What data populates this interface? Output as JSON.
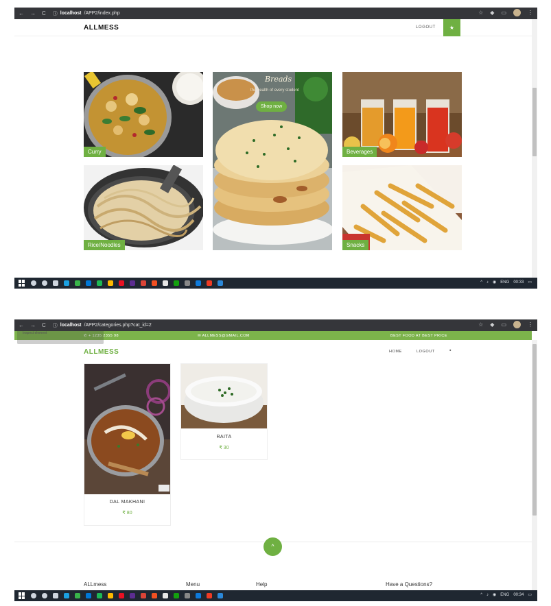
{
  "screenshot1": {
    "browser": {
      "url_host": "localhost",
      "url_path": "/APP2/index.php",
      "nav_back": "←",
      "nav_forward": "→",
      "nav_reload": "C",
      "info_icon": "ⓘ",
      "star_icon": "☆",
      "menu_icon": "⋮"
    },
    "header": {
      "brand": "ALLMESS",
      "logout": "LOGOUT",
      "cart_glyph": "★"
    },
    "tiles": {
      "curry": "Curry",
      "beverages": "Beverages",
      "rice": "Rice/Noodles",
      "snacks": "Snacks"
    },
    "promo": {
      "title": "Breads",
      "subtitle": "the health of every student",
      "button": "Shop now"
    },
    "taskbar": {
      "lang": "ENG",
      "time": "00:33"
    }
  },
  "screenshot2": {
    "browser": {
      "url_host": "localhost",
      "url_path": "/APP2/categories.php?cat_id=2",
      "nav_reload": "C",
      "info_icon": "ⓘ",
      "star_icon": "☆",
      "menu_icon": "⋮"
    },
    "tooltip": "Inspect element",
    "topbar": {
      "phone": "+ 1235 2355 98",
      "email": "ALLMESS@GMAIL.COM",
      "tagline": "BEST FOOD AT BEST PRICE"
    },
    "header": {
      "brand": "ALLMESS",
      "home": "HOME",
      "logout": "LOGOUT",
      "cart_glyph": "🛒"
    },
    "products": [
      {
        "name": "DAL MAKHANI",
        "price": "₹ 80"
      },
      {
        "name": "RAITA",
        "price": "₹ 30"
      }
    ],
    "scroll_top_glyph": "^",
    "footer": {
      "col1": "ALLmess",
      "col2": "Menu",
      "col3": "Help",
      "col4": "Have a Questions?"
    },
    "taskbar": {
      "lang": "ENG",
      "time": "00:34"
    }
  },
  "colors": {
    "accent": "#6fb042",
    "chrome": "#35363a",
    "taskbar": "#1f2731"
  }
}
